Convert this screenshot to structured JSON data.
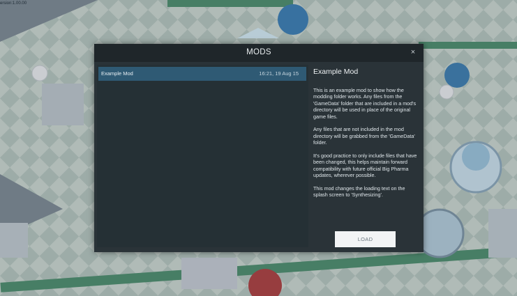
{
  "version_text": "ersion:1.00.00",
  "modal": {
    "title": "MODS",
    "close_label": "×",
    "load_label": "LOAD"
  },
  "mods": [
    {
      "name": "Example Mod",
      "date": "16:21, 19 Aug 15"
    }
  ],
  "detail": {
    "title": "Example Mod",
    "paragraphs": [
      "This is an example mod to show how the modding folder works. Any files from the 'GameData' folder that are included in a mod's directory will be used in place of the original game files.",
      "Any files that are not included in the mod directory will be grabbed from the 'GameData' folder.",
      "It's good practice to only include files that have been changed, this helps maintain forward compatibility with future official Big Pharma updates, wherever possible.",
      "This mod changes the loading text on the splash screen to 'Synthesizing'."
    ]
  },
  "colors": {
    "modal_bg": "#2a3338",
    "header_bg": "#1f262a",
    "selected_row": "#2f5a74",
    "load_button": "#f2f4f5"
  }
}
